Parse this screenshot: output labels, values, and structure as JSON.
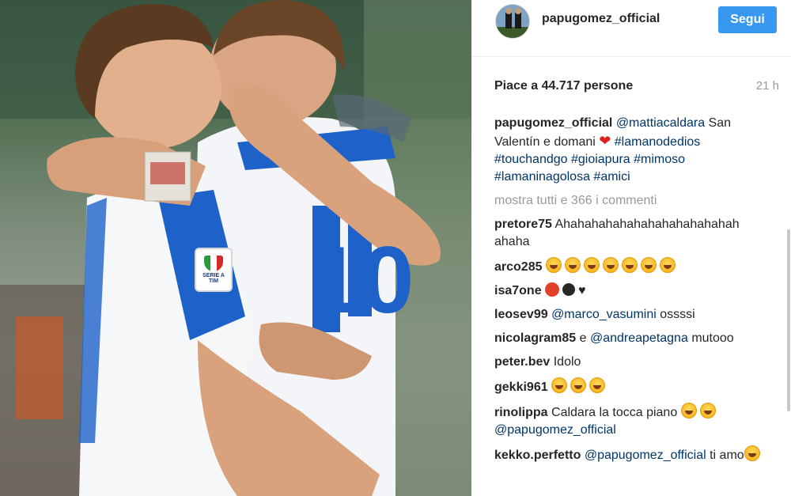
{
  "post": {
    "username": "papugomez_official",
    "follow_label": "Segui",
    "likes_text": "Piace a 44.717 persone",
    "time": "21 h"
  },
  "caption": {
    "user": "papugomez_official",
    "mention": "@mattiacaldara",
    "text_1": " San Valentín e domani ",
    "heart": "❤",
    "hashtags": "#lamanodedios #touchandgo #gioiapura #mimoso #lamaninagolosa #amici"
  },
  "view_all_comments": "mostra tutti e 366 i commenti",
  "comments": [
    {
      "user": "pretore75",
      "text": "Ahahahahahahahahahahahahah ahaha"
    },
    {
      "user": "arco285",
      "text": ""
    },
    {
      "user": "isa7one",
      "text": ""
    },
    {
      "user": "leosev99",
      "mention": "@marco_vasumini",
      "text": " ossssi"
    },
    {
      "user": "nicolagram85",
      "text": "e ",
      "mention": "@andreapetagna",
      "text_2": " mutooo"
    },
    {
      "user": "peter.bev",
      "text": "Idolo"
    },
    {
      "user": "gekki961",
      "text": ""
    },
    {
      "user": "rinolippa",
      "text": "Caldara la tocca piano ",
      "mention": "@papugomez_official"
    },
    {
      "user": "kekko.perfetto",
      "mention": "@papugomez_official",
      "text": " ti amo"
    }
  ],
  "photo": {
    "badge_top": "SERIE A",
    "badge_bottom": "TIM"
  },
  "colors": {
    "follow_button": "#3897f0",
    "link": "#003569",
    "muted": "#999999",
    "kit_blue": "#1e62c9"
  }
}
